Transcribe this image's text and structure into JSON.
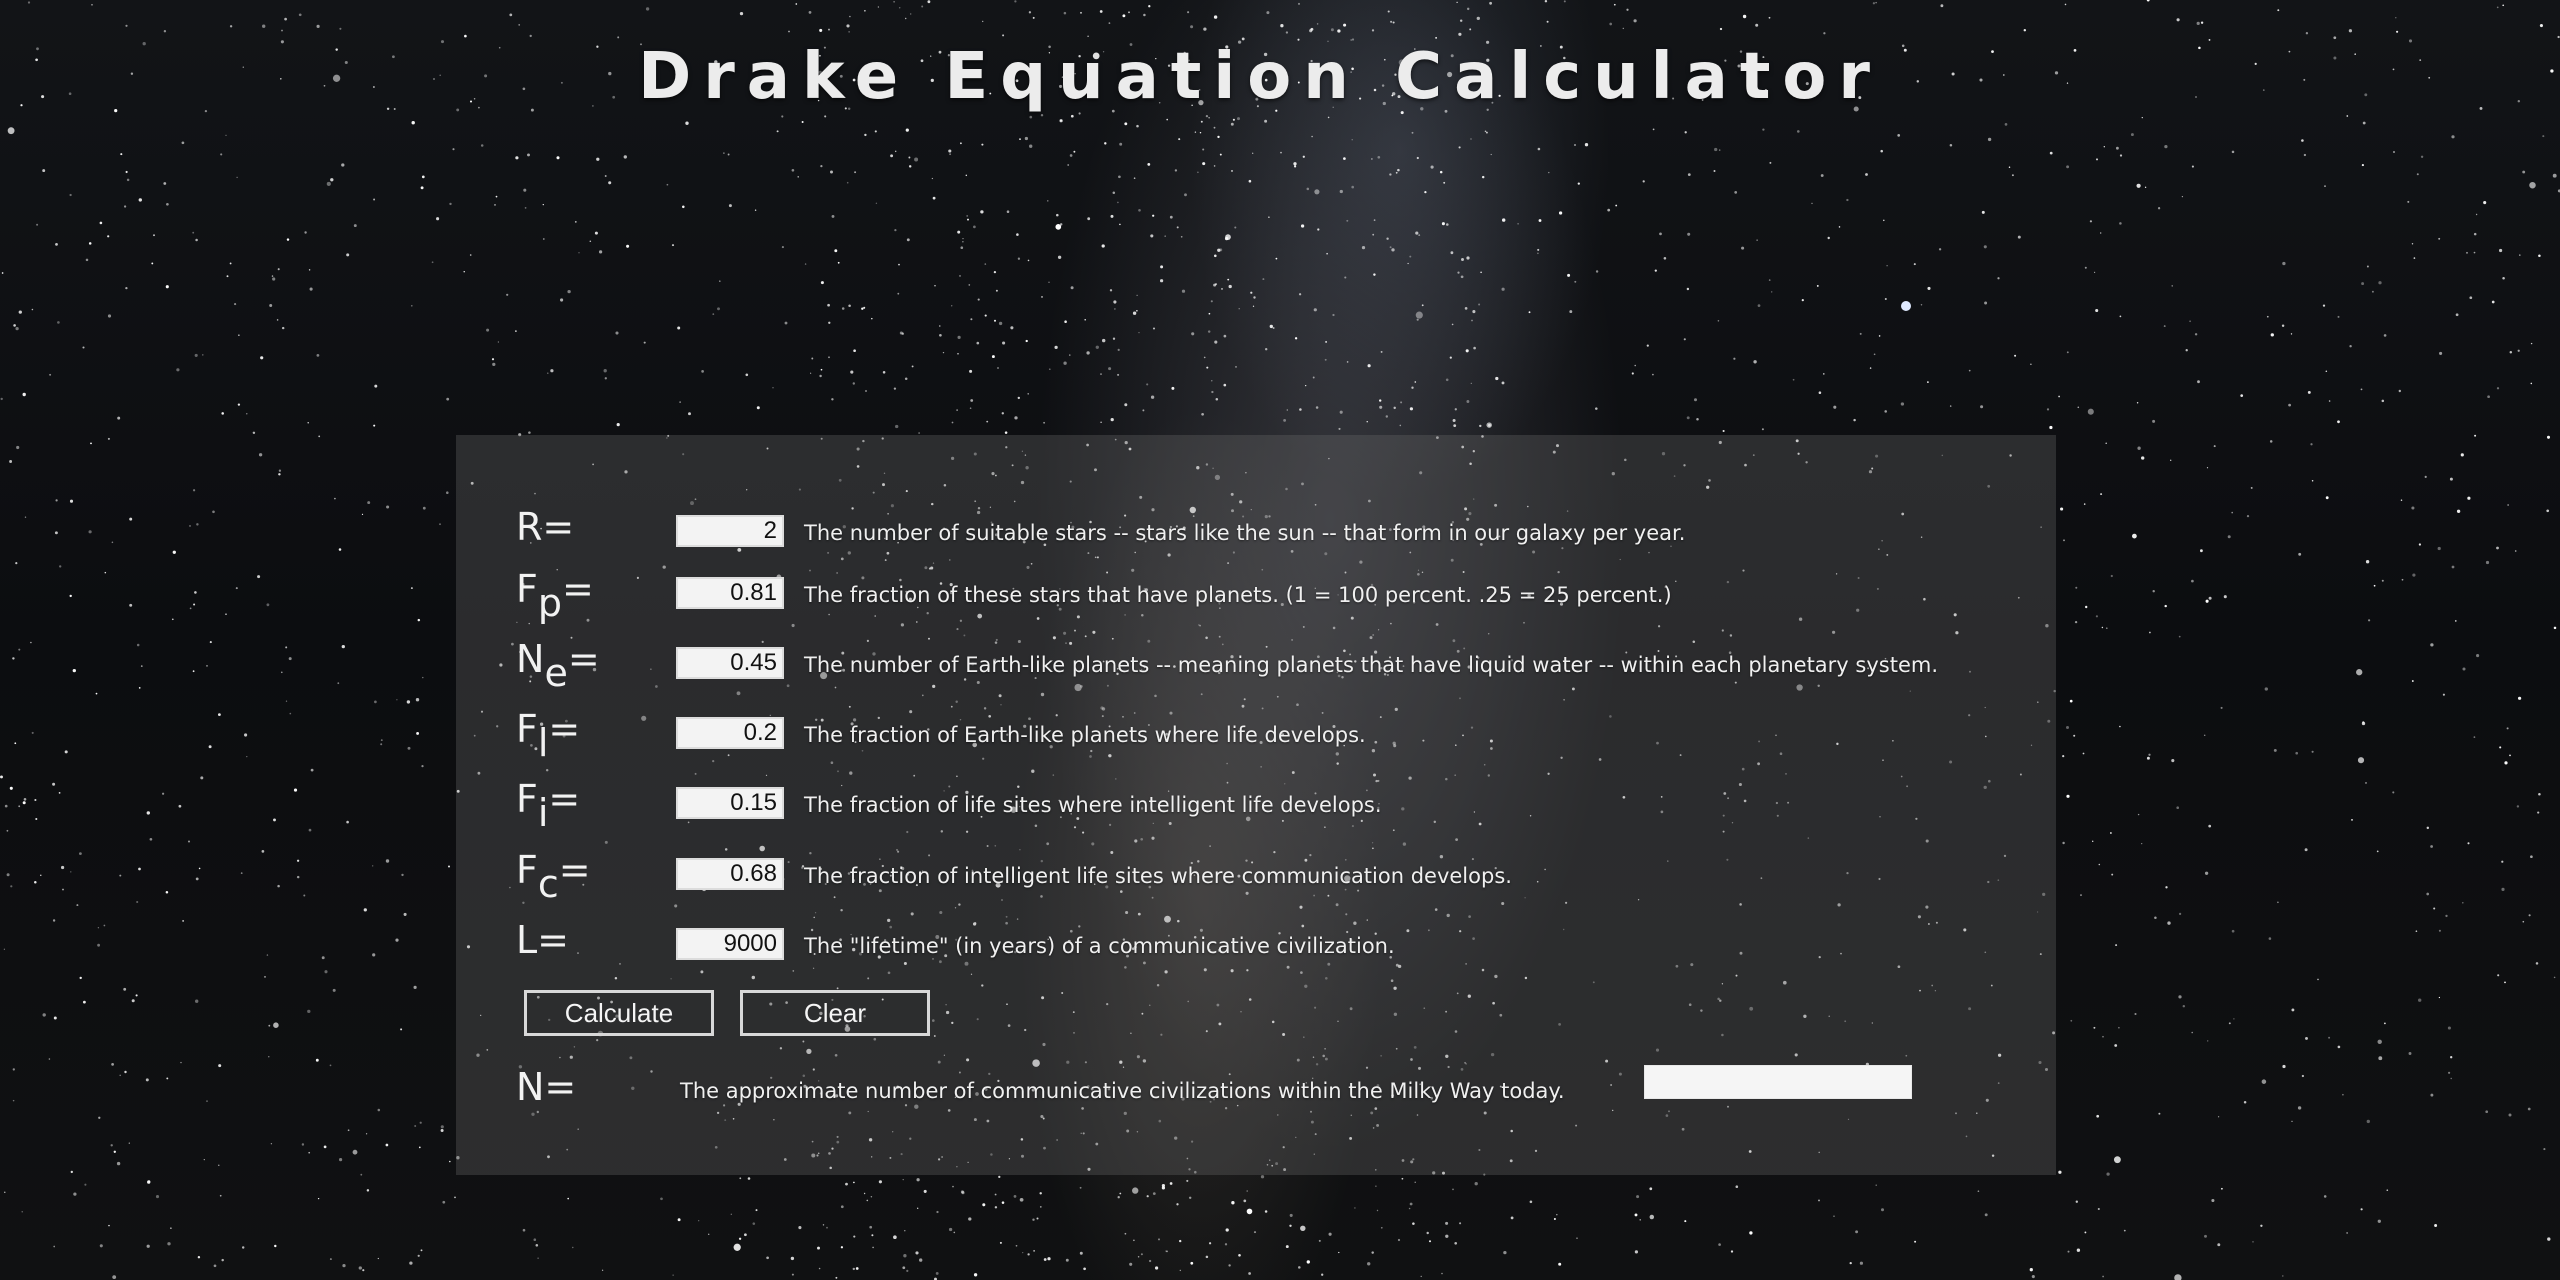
{
  "page": {
    "title": "Drake Equation Calculator"
  },
  "form": {
    "rows": [
      {
        "symbol": "R",
        "subscript": "",
        "suffix": "=",
        "value": "2",
        "description": "The number of suitable stars -- stars like the sun -- that form in our galaxy per year."
      },
      {
        "symbol": "F",
        "subscript": "p",
        "suffix": "=",
        "value": "0.81",
        "description": "The fraction of these stars that have planets. (1 = 100 percent. .25 = 25 percent.)"
      },
      {
        "symbol": "N",
        "subscript": "e",
        "suffix": "=",
        "value": "0.45",
        "description": "The number of Earth-like planets -- meaning planets that have liquid water -- within each planetary system."
      },
      {
        "symbol": "F",
        "subscript": "l",
        "suffix": "=",
        "value": "0.2",
        "description": "The fraction of Earth-like planets where life develops."
      },
      {
        "symbol": "F",
        "subscript": "i",
        "suffix": "=",
        "value": "0.15",
        "description": "The fraction of life sites where intelligent life develops."
      },
      {
        "symbol": "F",
        "subscript": "c",
        "suffix": "=",
        "value": "0.68",
        "description": "The fraction of intelligent life sites where communication develops."
      },
      {
        "symbol": "L",
        "subscript": "",
        "suffix": "=",
        "value": "9000",
        "description": "The \"lifetime\" (in years) of a communicative civilization."
      }
    ],
    "buttons": {
      "calculate_label": "Calculate",
      "clear_label": "Clear"
    },
    "result": {
      "symbol": "N=",
      "description": "The approximate number of communicative civilizations within the Milky Way today.",
      "value": ""
    }
  }
}
